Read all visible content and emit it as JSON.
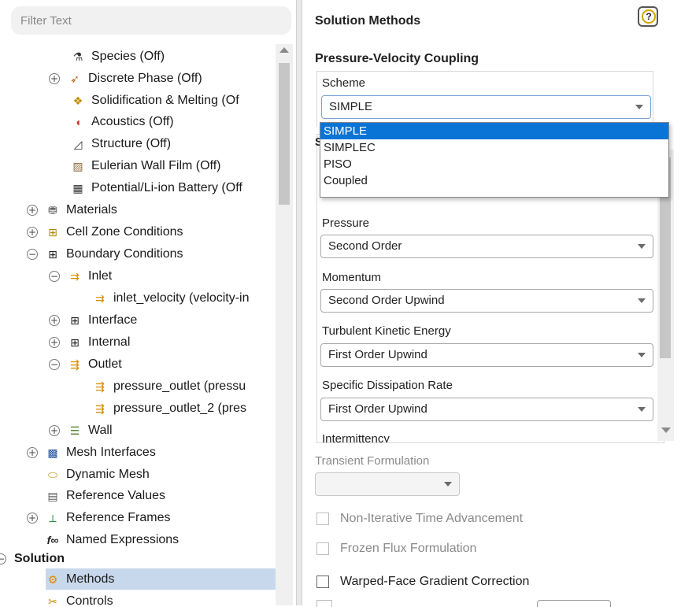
{
  "filter": {
    "placeholder": "Filter Text"
  },
  "tree": {
    "species": "Species (Off)",
    "discrete_phase": "Discrete Phase (Off)",
    "solidification": "Solidification & Melting (Of",
    "acoustics": "Acoustics (Off)",
    "structure": "Structure (Off)",
    "eulerian": "Eulerian Wall Film (Off)",
    "battery": "Potential/Li-ion Battery (Off",
    "materials": "Materials",
    "cell_zone": "Cell Zone Conditions",
    "boundary": "Boundary Conditions",
    "inlet": "Inlet",
    "inlet_velocity": "inlet_velocity (velocity-in",
    "interface": "Interface",
    "internal": "Internal",
    "outlet": "Outlet",
    "pressure_outlet": "pressure_outlet (pressu",
    "pressure_outlet_2": "pressure_outlet_2 (pres",
    "wall": "Wall",
    "mesh_interfaces": "Mesh Interfaces",
    "dynamic_mesh": "Dynamic Mesh",
    "reference_values": "Reference Values",
    "reference_frames": "Reference Frames",
    "named_expressions": "Named Expressions",
    "solution": "Solution",
    "methods": "Methods",
    "controls": "Controls"
  },
  "panel": {
    "title": "Solution Methods",
    "help": "?",
    "pvc_title": "Pressure-Velocity Coupling",
    "scheme_label": "Scheme",
    "scheme_value": "SIMPLE",
    "scheme_options": [
      "SIMPLE",
      "SIMPLEC",
      "PISO",
      "Coupled"
    ],
    "disc_partial": "S",
    "pressure_label": "Pressure",
    "pressure_value": "Second Order",
    "momentum_label": "Momentum",
    "momentum_value": "Second Order Upwind",
    "tke_label": "Turbulent Kinetic Energy",
    "tke_value": "First Order Upwind",
    "sdr_label": "Specific Dissipation Rate",
    "sdr_value": "First Order Upwind",
    "intermittency_label": "Intermittency",
    "transient_label": "Transient Formulation",
    "transient_value": "",
    "chk_nita": "Non-Iterative Time Advancement",
    "chk_frozen": "Frozen Flux Formulation",
    "chk_warped": "Warped-Face Gradient Correction"
  },
  "colors": {
    "selection": "#0a74d6",
    "tree_selected": "#c8d8ec"
  }
}
